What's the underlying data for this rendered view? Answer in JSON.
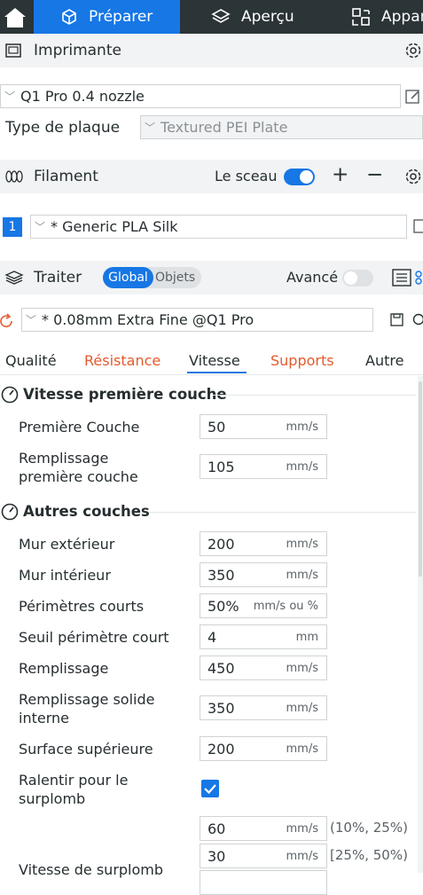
{
  "topbar": {
    "home_icon": "home-icon",
    "tabs": [
      {
        "label": "Préparer",
        "icon": "cube-icon"
      },
      {
        "label": "Aperçu",
        "icon": "layers-icon"
      },
      {
        "label": "Appar",
        "icon": "device-icon"
      }
    ]
  },
  "printer": {
    "title": "Imprimante",
    "selected": "Q1 Pro 0.4 nozzle",
    "plate_label": "Type de plaque",
    "plate_value": "Textured PEI Plate"
  },
  "filament": {
    "title": "Filament",
    "seal_label": "Le sceau",
    "plus": "+",
    "minus": "−",
    "index": "1",
    "selected": "* Generic PLA Silk"
  },
  "process": {
    "title": "Traiter",
    "toggle_global": "Global",
    "toggle_objects": "Objets",
    "advanced_label": "Avancé",
    "preset": "* 0.08mm Extra Fine @Q1 Pro"
  },
  "settings_tabs": [
    "Qualité",
    "Résistance",
    "Vitesse",
    "Supports",
    "Autre"
  ],
  "groups": {
    "first_layer": "Vitesse première couche",
    "other_layers": "Autres couches"
  },
  "fields": {
    "first_layer": {
      "label": "Première Couche",
      "value": "50",
      "unit": "mm/s"
    },
    "first_infill": {
      "label1": "Remplissage",
      "label2": "première couche",
      "value": "105",
      "unit": "mm/s"
    },
    "outer_wall": {
      "label": "Mur extérieur",
      "value": "200",
      "unit": "mm/s"
    },
    "inner_wall": {
      "label": "Mur intérieur",
      "value": "350",
      "unit": "mm/s"
    },
    "small_perim": {
      "label": "Périmètres courts",
      "value": "50%",
      "unit": "mm/s ou %"
    },
    "small_perim_thr": {
      "label": "Seuil périmètre court",
      "value": "4",
      "unit": "mm"
    },
    "infill": {
      "label": "Remplissage",
      "value": "450",
      "unit": "mm/s"
    },
    "solid_infill": {
      "label1": "Remplissage solide",
      "label2": "interne",
      "value": "350",
      "unit": "mm/s"
    },
    "top_surface": {
      "label": "Surface supérieure",
      "value": "200",
      "unit": "mm/s"
    },
    "slow_overhang": {
      "label1": "Ralentir pour le",
      "label2": "surplomb",
      "checked": true
    },
    "overhang_speed": {
      "label": "Vitesse de surplomb",
      "rows": [
        {
          "value": "60",
          "unit": "mm/s",
          "range": "(10%, 25%)"
        },
        {
          "value": "30",
          "unit": "mm/s",
          "range": "[25%, 50%)"
        }
      ]
    }
  },
  "colors": {
    "accent": "#1677e5",
    "topbar": "#2b3437",
    "orange": "#e35a2b"
  }
}
